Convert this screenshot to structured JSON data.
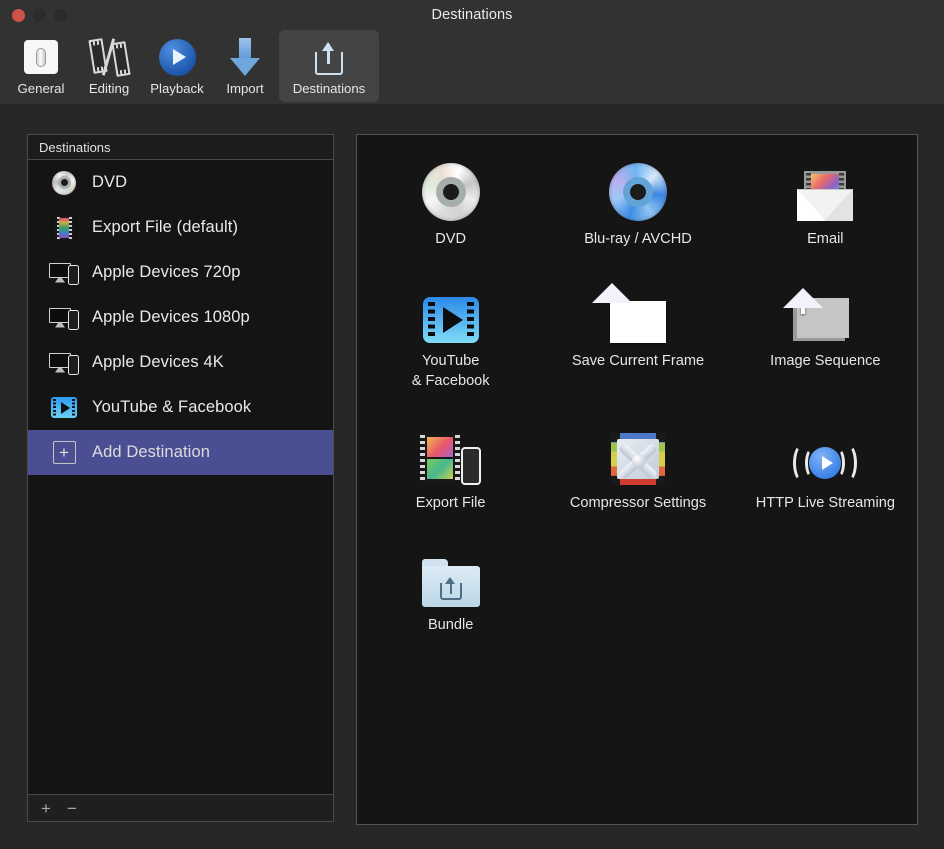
{
  "window": {
    "title": "Destinations",
    "controls": {
      "close": "close-button",
      "minimize": "minimize-button",
      "maximize": "maximize-button"
    }
  },
  "toolbar": {
    "tabs": [
      {
        "label": "General",
        "icon": "toggle-switch-icon",
        "selected": false
      },
      {
        "label": "Editing",
        "icon": "filmstrip-icon",
        "selected": false
      },
      {
        "label": "Playback",
        "icon": "play-circle-icon",
        "selected": false
      },
      {
        "label": "Import",
        "icon": "down-arrow-icon",
        "selected": false
      },
      {
        "label": "Destinations",
        "icon": "share-export-icon",
        "selected": true
      }
    ]
  },
  "sidebar": {
    "header": "Destinations",
    "items": [
      {
        "label": "DVD",
        "icon": "dvd-disc-icon",
        "selected": false
      },
      {
        "label": "Export File (default)",
        "icon": "filmstrip-icon",
        "selected": false
      },
      {
        "label": "Apple Devices 720p",
        "icon": "devices-icon",
        "selected": false
      },
      {
        "label": "Apple Devices 1080p",
        "icon": "devices-icon",
        "selected": false
      },
      {
        "label": "Apple Devices 4K",
        "icon": "devices-icon",
        "selected": false
      },
      {
        "label": "YouTube & Facebook",
        "icon": "video-play-icon",
        "selected": false
      },
      {
        "label": "Add Destination",
        "icon": "plus-box-icon",
        "selected": true
      }
    ],
    "footer": {
      "add": "+",
      "remove": "−"
    },
    "selection_color": "#4a4f93"
  },
  "destinations": {
    "items": [
      {
        "label": "DVD",
        "icon": "dvd-disc-icon"
      },
      {
        "label": "Blu-ray / AVCHD",
        "icon": "bluray-disc-icon"
      },
      {
        "label": "Email",
        "icon": "envelope-icon"
      },
      {
        "label": "YouTube\n& Facebook",
        "icon": "video-play-icon"
      },
      {
        "label": "Save Current Frame",
        "icon": "photo-icon"
      },
      {
        "label": "Image Sequence",
        "icon": "photo-stack-icon"
      },
      {
        "label": "Export File",
        "icon": "film-device-icon"
      },
      {
        "label": "Compressor Settings",
        "icon": "compressor-icon"
      },
      {
        "label": "HTTP Live Streaming",
        "icon": "broadcast-play-icon"
      },
      {
        "label": "Bundle",
        "icon": "folder-share-icon"
      }
    ]
  }
}
